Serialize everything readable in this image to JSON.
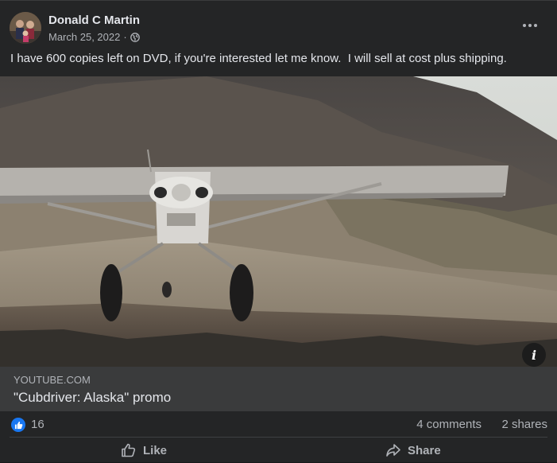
{
  "post": {
    "author": "Donald C Martin",
    "date": "March 25, 2022",
    "separator": "·",
    "privacy_icon": "globe-icon",
    "more_icon": "more-options-icon",
    "text": "I have 600 copies left on DVD, if you're interested let me know.  I will sell at cost plus shipping."
  },
  "link_preview": {
    "domain": "YOUTUBE.COM",
    "title": "\"Cubdriver: Alaska\" promo",
    "info_label": "i"
  },
  "stats": {
    "reaction_icon": "like-reaction-icon",
    "reaction_count": "16",
    "comments": "4 comments",
    "shares": "2 shares"
  },
  "actions": {
    "like": "Like",
    "share": "Share"
  },
  "colors": {
    "card_bg": "#242526",
    "link_bg": "#3a3b3c",
    "accent": "#1877f2",
    "text_primary": "#e4e6eb",
    "text_secondary": "#b0b3b8"
  }
}
